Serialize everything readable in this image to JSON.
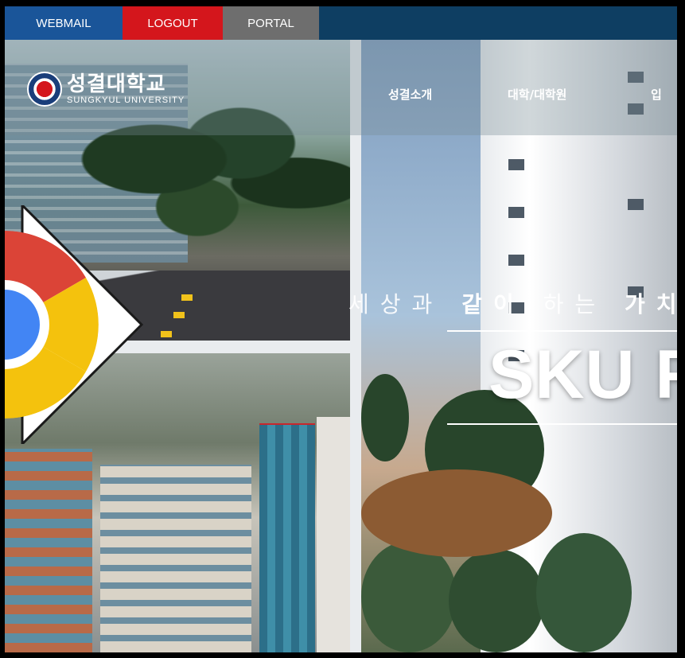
{
  "topbar": {
    "webmail": "WEBMAIL",
    "logout": "LOGOUT",
    "portal": "PORTAL"
  },
  "logo": {
    "korean": "성결대학교",
    "english": "SUNGKYUL UNIVERSITY"
  },
  "nav": {
    "items": [
      "성결소개",
      "대학/대학원",
      "입"
    ]
  },
  "hero": {
    "subtitle_part1": "세상과 ",
    "subtitle_bold1": "같이",
    "subtitle_part2": " 하는 ",
    "subtitle_bold2": "가치",
    "title": "SKU Fo"
  },
  "icons": {
    "chrome": "chrome-logo-icon",
    "arrow": "arrow-right-icon"
  },
  "colors": {
    "webmail_bg": "#1a5599",
    "logout_bg": "#d4161c",
    "portal_bg": "#6e6e6e",
    "topbar_bg": "#0e3e62"
  }
}
